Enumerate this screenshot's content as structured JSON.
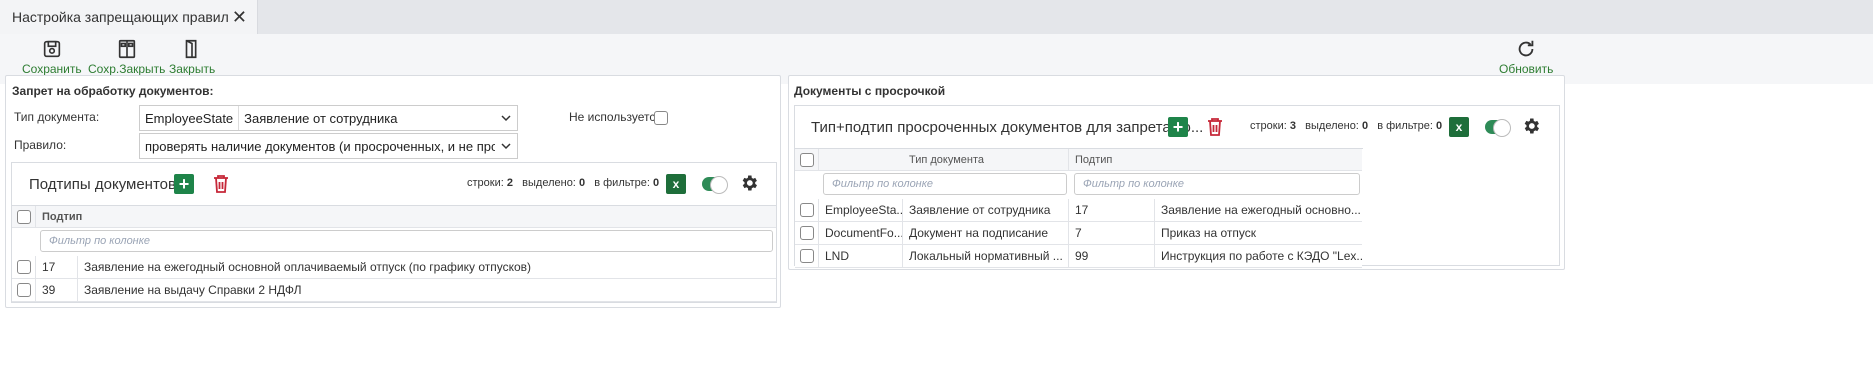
{
  "tab": {
    "title": "Настройка запрещающих правил",
    "close": "✕"
  },
  "toolbar": {
    "save": "Сохранить",
    "save_close": "Сохр.Закрыть",
    "close": "Закрыть",
    "refresh": "Обновить"
  },
  "left": {
    "title": "Запрет на обработку документов:",
    "doc_type_label": "Тип документа:",
    "doc_type_code": "EmployeeState",
    "doc_type_value": "Заявление от сотрудника",
    "not_used_label": "Не используется",
    "rule_label": "Правило:",
    "rule_value": "проверять наличие документов (и просроченных, и не просроче",
    "grid": {
      "title": "Подтипы документов",
      "rows_label": "строки:",
      "rows": "2",
      "selected_label": "выделено:",
      "selected": "0",
      "filtered_label": "в фильтре:",
      "filtered": "0",
      "xls": "x",
      "col_subtype": "Подтип",
      "filter_placeholder": "Фильтр по колонке",
      "data": [
        {
          "code": "17",
          "name": "Заявление на ежегодный основной оплачиваемый отпуск (по графику отпусков)"
        },
        {
          "code": "39",
          "name": "Заявление на выдачу Справки 2 НДФЛ"
        }
      ]
    }
  },
  "right": {
    "title": "Документы с просрочкой",
    "grid": {
      "title": "Тип+подтип просроченных документов для запрета со...",
      "rows_label": "строки:",
      "rows": "3",
      "selected_label": "выделено:",
      "selected": "0",
      "filtered_label": "в фильтре:",
      "filtered": "0",
      "xls": "x",
      "col_type": "Тип документа",
      "col_subtype": "Подтип",
      "filter_placeholder": "Фильтр по колонке",
      "data": [
        {
          "type_code": "EmployeeSta...",
          "type_name": "Заявление от сотрудника",
          "sub_code": "17",
          "sub_name": "Заявление на ежегодный основно..."
        },
        {
          "type_code": "DocumentFo...",
          "type_name": "Документ на подписание",
          "sub_code": "7",
          "sub_name": "Приказ на отпуск"
        },
        {
          "type_code": "LND",
          "type_name": "Локальный нормативный ...",
          "sub_code": "99",
          "sub_name": "Инструкция по работе с КЭДО \"Lex..."
        }
      ]
    }
  }
}
